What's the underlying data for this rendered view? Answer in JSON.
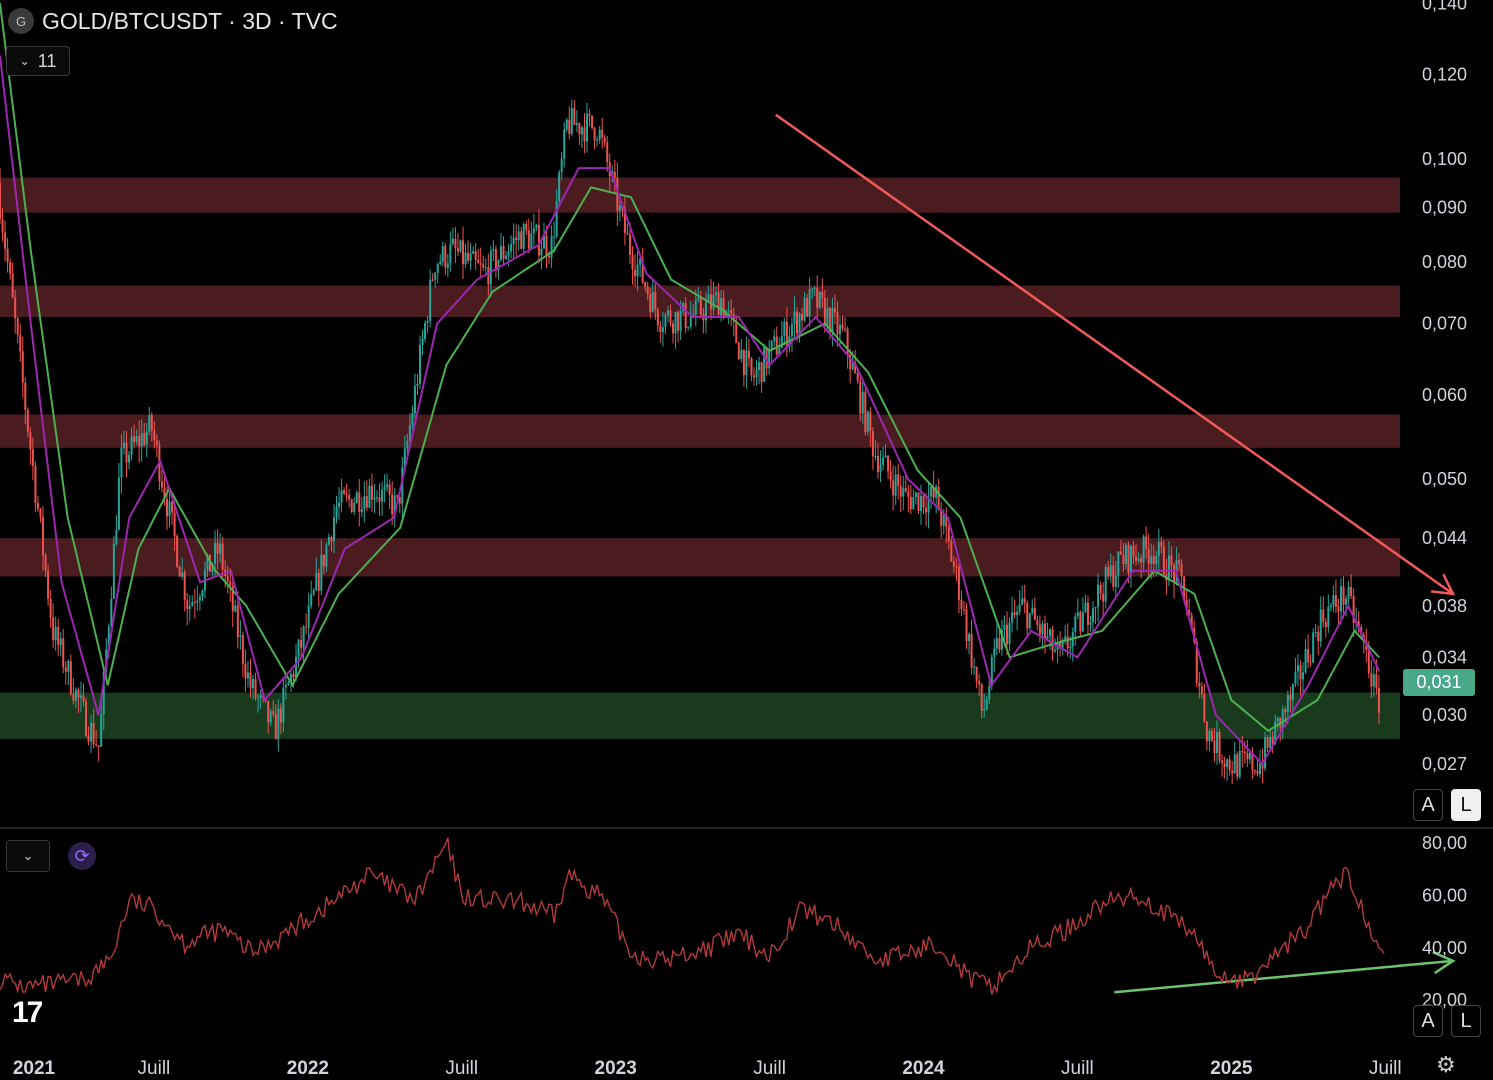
{
  "header": {
    "symbol_badge": "G",
    "title": "GOLD/BTCUSDT · 3D · TVC",
    "indicator_count": "11",
    "chevron": "⌄"
  },
  "colors": {
    "up_candle": "#26a69a",
    "down_candle": "#ef5350",
    "ma_fast": "#9c27b0",
    "ma_slow": "#4caf50",
    "resistance_zone": "#4a1c1f",
    "support_zone": "#1a3a1e",
    "trend_arrow_red": "#f05a5a",
    "trend_arrow_green": "#6cc46c",
    "rsi_line": "#b23a3a",
    "price_tag": "#4aa88a"
  },
  "icons": {
    "logo": "tradingview-logo-icon",
    "settings": "gear-icon",
    "sync": "sync-icon"
  },
  "price_scale_buttons": {
    "auto": "A",
    "log": "L"
  },
  "rsi_scale_buttons": {
    "auto": "A",
    "log": "L"
  },
  "current_price_label": "0,031",
  "rsi_sync_glyph": "⟳",
  "gear_glyph": "⚙",
  "logo_text": "17",
  "chart_data": [
    {
      "type": "candlestick",
      "title": "GOLD/BTCUSDT · 3D · TVC",
      "y_scale": "log",
      "ylim": [
        0.0235,
        0.141
      ],
      "xlim": [
        2021.0,
        2025.85
      ],
      "y_tick_values": [
        0.14,
        0.12,
        0.1,
        0.09,
        0.08,
        0.07,
        0.06,
        0.05,
        0.044,
        0.038,
        0.034,
        0.03,
        0.027
      ],
      "y_tick_labels": [
        "0,140",
        "0,120",
        "0,100",
        "0,090",
        "0,080",
        "0,070",
        "0,060",
        "0,050",
        "0,044",
        "0,038",
        "0,034",
        "0,030",
        "0,027"
      ],
      "x_ticks": [
        {
          "value": 2021.0,
          "label": "2021",
          "bold": true
        },
        {
          "value": 2021.5,
          "label": "Juill",
          "bold": false
        },
        {
          "value": 2022.0,
          "label": "2022",
          "bold": true
        },
        {
          "value": 2022.5,
          "label": "Juill",
          "bold": false
        },
        {
          "value": 2023.0,
          "label": "2023",
          "bold": true
        },
        {
          "value": 2023.5,
          "label": "Juill",
          "bold": false
        },
        {
          "value": 2024.0,
          "label": "2024",
          "bold": true
        },
        {
          "value": 2024.5,
          "label": "Juill",
          "bold": false
        },
        {
          "value": 2025.0,
          "label": "2025",
          "bold": true
        },
        {
          "value": 2025.5,
          "label": "Juill",
          "bold": false
        }
      ],
      "price_keypoints": [
        [
          2021.0,
          0.095
        ],
        [
          2021.08,
          0.062
        ],
        [
          2021.18,
          0.036
        ],
        [
          2021.28,
          0.03
        ],
        [
          2021.33,
          0.028
        ],
        [
          2021.4,
          0.052
        ],
        [
          2021.5,
          0.056
        ],
        [
          2021.62,
          0.038
        ],
        [
          2021.72,
          0.043
        ],
        [
          2021.82,
          0.032
        ],
        [
          2021.9,
          0.029
        ],
        [
          2022.0,
          0.036
        ],
        [
          2022.1,
          0.047
        ],
        [
          2022.22,
          0.049
        ],
        [
          2022.3,
          0.047
        ],
        [
          2022.42,
          0.08
        ],
        [
          2022.48,
          0.082
        ],
        [
          2022.58,
          0.078
        ],
        [
          2022.7,
          0.085
        ],
        [
          2022.8,
          0.083
        ],
        [
          2022.85,
          0.108
        ],
        [
          2022.95,
          0.107
        ],
        [
          2023.05,
          0.083
        ],
        [
          2023.15,
          0.071
        ],
        [
          2023.25,
          0.071
        ],
        [
          2023.35,
          0.074
        ],
        [
          2023.45,
          0.062
        ],
        [
          2023.55,
          0.068
        ],
        [
          2023.65,
          0.074
        ],
        [
          2023.75,
          0.068
        ],
        [
          2023.85,
          0.053
        ],
        [
          2023.95,
          0.048
        ],
        [
          2024.05,
          0.048
        ],
        [
          2024.12,
          0.04
        ],
        [
          2024.2,
          0.03
        ],
        [
          2024.25,
          0.035
        ],
        [
          2024.33,
          0.038
        ],
        [
          2024.45,
          0.034
        ],
        [
          2024.55,
          0.038
        ],
        [
          2024.65,
          0.042
        ],
        [
          2024.75,
          0.043
        ],
        [
          2024.85,
          0.04
        ],
        [
          2024.93,
          0.029
        ],
        [
          2025.0,
          0.027
        ],
        [
          2025.1,
          0.027
        ],
        [
          2025.2,
          0.031
        ],
        [
          2025.3,
          0.037
        ],
        [
          2025.38,
          0.039
        ],
        [
          2025.45,
          0.034
        ],
        [
          2025.48,
          0.031
        ]
      ],
      "ma_fast_keypoints": [
        [
          2021.0,
          0.125
        ],
        [
          2021.1,
          0.07
        ],
        [
          2021.2,
          0.04
        ],
        [
          2021.32,
          0.03
        ],
        [
          2021.42,
          0.046
        ],
        [
          2021.52,
          0.052
        ],
        [
          2021.65,
          0.04
        ],
        [
          2021.75,
          0.041
        ],
        [
          2021.86,
          0.031
        ],
        [
          2021.98,
          0.034
        ],
        [
          2022.12,
          0.043
        ],
        [
          2022.28,
          0.046
        ],
        [
          2022.42,
          0.07
        ],
        [
          2022.55,
          0.077
        ],
        [
          2022.75,
          0.083
        ],
        [
          2022.88,
          0.098
        ],
        [
          2022.98,
          0.098
        ],
        [
          2023.1,
          0.078
        ],
        [
          2023.25,
          0.071
        ],
        [
          2023.4,
          0.071
        ],
        [
          2023.5,
          0.064
        ],
        [
          2023.65,
          0.071
        ],
        [
          2023.78,
          0.064
        ],
        [
          2023.95,
          0.05
        ],
        [
          2024.08,
          0.046
        ],
        [
          2024.22,
          0.032
        ],
        [
          2024.35,
          0.036
        ],
        [
          2024.5,
          0.034
        ],
        [
          2024.68,
          0.041
        ],
        [
          2024.82,
          0.041
        ],
        [
          2024.95,
          0.03
        ],
        [
          2025.1,
          0.027
        ],
        [
          2025.25,
          0.032
        ],
        [
          2025.38,
          0.038
        ],
        [
          2025.48,
          0.033
        ]
      ],
      "ma_slow_keypoints": [
        [
          2021.0,
          0.14
        ],
        [
          2021.1,
          0.082
        ],
        [
          2021.22,
          0.046
        ],
        [
          2021.35,
          0.032
        ],
        [
          2021.45,
          0.043
        ],
        [
          2021.55,
          0.049
        ],
        [
          2021.7,
          0.041
        ],
        [
          2021.8,
          0.038
        ],
        [
          2021.95,
          0.032
        ],
        [
          2022.1,
          0.039
        ],
        [
          2022.3,
          0.045
        ],
        [
          2022.45,
          0.064
        ],
        [
          2022.6,
          0.075
        ],
        [
          2022.8,
          0.082
        ],
        [
          2022.92,
          0.094
        ],
        [
          2023.05,
          0.092
        ],
        [
          2023.18,
          0.077
        ],
        [
          2023.35,
          0.072
        ],
        [
          2023.5,
          0.066
        ],
        [
          2023.68,
          0.07
        ],
        [
          2023.82,
          0.063
        ],
        [
          2023.98,
          0.051
        ],
        [
          2024.12,
          0.046
        ],
        [
          2024.28,
          0.034
        ],
        [
          2024.42,
          0.035
        ],
        [
          2024.58,
          0.036
        ],
        [
          2024.75,
          0.041
        ],
        [
          2024.88,
          0.039
        ],
        [
          2025.0,
          0.031
        ],
        [
          2025.12,
          0.029
        ],
        [
          2025.28,
          0.031
        ],
        [
          2025.4,
          0.036
        ],
        [
          2025.48,
          0.034
        ]
      ],
      "zones": [
        {
          "kind": "resistance",
          "from": 0.089,
          "to": 0.096
        },
        {
          "kind": "resistance",
          "from": 0.071,
          "to": 0.076
        },
        {
          "kind": "resistance",
          "from": 0.0535,
          "to": 0.0575
        },
        {
          "kind": "resistance",
          "from": 0.0405,
          "to": 0.044
        },
        {
          "kind": "support",
          "from": 0.0285,
          "to": 0.0315
        }
      ],
      "annotations": [
        {
          "kind": "arrow",
          "color": "red",
          "from": [
            2023.52,
            0.11
          ],
          "to": [
            2025.72,
            0.039
          ]
        }
      ],
      "last_price": 0.031
    },
    {
      "type": "line",
      "title": "",
      "ylim": [
        4,
        85
      ],
      "xlim": [
        2021.0,
        2025.85
      ],
      "y_tick_values": [
        80,
        60,
        40,
        20
      ],
      "y_tick_labels": [
        "80,00",
        "60,00",
        "40,00",
        "20,00"
      ],
      "x": [
        2021.0,
        2021.08,
        2021.18,
        2021.28,
        2021.36,
        2021.42,
        2021.5,
        2021.6,
        2021.72,
        2021.82,
        2021.92,
        2022.05,
        2022.2,
        2022.35,
        2022.45,
        2022.5,
        2022.58,
        2022.7,
        2022.8,
        2022.85,
        2022.95,
        2023.05,
        2023.15,
        2023.3,
        2023.4,
        2023.5,
        2023.6,
        2023.7,
        2023.85,
        2023.95,
        2024.05,
        2024.15,
        2024.22,
        2024.35,
        2024.48,
        2024.58,
        2024.7,
        2024.82,
        2024.88,
        2024.95,
        2025.05,
        2025.15,
        2025.25,
        2025.32,
        2025.38,
        2025.45,
        2025.5
      ],
      "values": [
        28,
        25,
        26,
        28,
        36,
        58,
        55,
        42,
        47,
        38,
        45,
        55,
        68,
        58,
        80,
        60,
        58,
        57,
        52,
        68,
        60,
        38,
        35,
        40,
        45,
        37,
        55,
        50,
        35,
        38,
        42,
        28,
        25,
        40,
        48,
        57,
        60,
        50,
        45,
        30,
        27,
        38,
        48,
        62,
        68,
        48,
        41
      ],
      "annotations": [
        {
          "kind": "arrow",
          "color": "green",
          "from": [
            2024.62,
            23
          ],
          "to": [
            2025.72,
            35
          ]
        }
      ]
    }
  ]
}
